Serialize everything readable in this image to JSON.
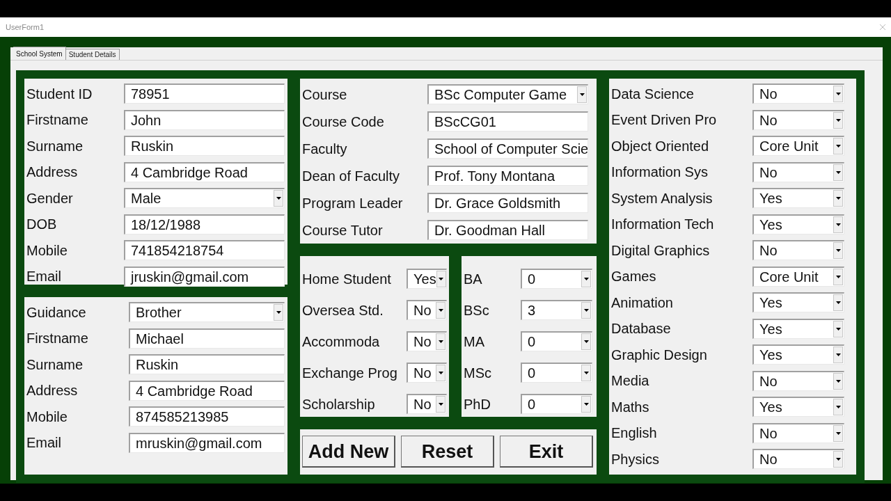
{
  "window": {
    "title": "UserForm1"
  },
  "tabs": [
    {
      "label": "School System",
      "selected": true
    },
    {
      "label": "Student Details",
      "selected": false
    }
  ],
  "student": [
    {
      "label": "Student ID",
      "value": "78951",
      "kind": "text"
    },
    {
      "label": "Firstname",
      "value": "John",
      "kind": "text"
    },
    {
      "label": "Surname",
      "value": "Ruskin",
      "kind": "text"
    },
    {
      "label": "Address",
      "value": "4 Cambridge Road",
      "kind": "text"
    },
    {
      "label": "Gender",
      "value": "Male",
      "kind": "dropdown"
    },
    {
      "label": "DOB",
      "value": "18/12/1988",
      "kind": "text"
    },
    {
      "label": "Mobile",
      "value": "741854218754",
      "kind": "text"
    },
    {
      "label": "Email",
      "value": "jruskin@gmail.com",
      "kind": "text"
    }
  ],
  "guidance": [
    {
      "label": "Guidance",
      "value": "Brother",
      "kind": "dropdown"
    },
    {
      "label": "Firstname",
      "value": "Michael",
      "kind": "text"
    },
    {
      "label": "Surname",
      "value": "Ruskin",
      "kind": "text"
    },
    {
      "label": "Address",
      "value": "4 Cambridge Road",
      "kind": "text"
    },
    {
      "label": "Mobile",
      "value": "874585213985",
      "kind": "text"
    },
    {
      "label": "Email",
      "value": "mruskin@gmail.com",
      "kind": "text"
    }
  ],
  "course": [
    {
      "label": "Course",
      "value": "BSc Computer Game",
      "kind": "dropdown"
    },
    {
      "label": "Course Code",
      "value": "BScCG01",
      "kind": "text"
    },
    {
      "label": "Faculty",
      "value": "School of Computer Scie",
      "kind": "text"
    },
    {
      "label": "Dean of Faculty",
      "value": "Prof. Tony Montana",
      "kind": "text"
    },
    {
      "label": "Program Leader",
      "value": "Dr. Grace Goldsmith",
      "kind": "text"
    },
    {
      "label": "Course Tutor",
      "value": "Dr. Goodman Hall",
      "kind": "text"
    }
  ],
  "status": [
    {
      "label": "Home Student",
      "value": "Yes",
      "kind": "dropdown"
    },
    {
      "label": "Oversea  Std.",
      "value": "No",
      "kind": "dropdown"
    },
    {
      "label": "Accommoda",
      "value": "No",
      "kind": "dropdown"
    },
    {
      "label": "Exchange Prog",
      "value": "No",
      "kind": "dropdown"
    },
    {
      "label": "Scholarship",
      "value": "No",
      "kind": "dropdown"
    }
  ],
  "degrees": [
    {
      "label": "BA",
      "value": "0",
      "kind": "dropdown"
    },
    {
      "label": "BSc",
      "value": "3",
      "kind": "dropdown"
    },
    {
      "label": "MA",
      "value": "0",
      "kind": "dropdown"
    },
    {
      "label": "MSc",
      "value": "0",
      "kind": "dropdown"
    },
    {
      "label": "PhD",
      "value": "0",
      "kind": "dropdown"
    }
  ],
  "buttons": [
    "Add New",
    "Reset",
    "Exit"
  ],
  "units": [
    {
      "label": "Data Science",
      "value": "No",
      "kind": "dropdown"
    },
    {
      "label": "Event Driven Pro",
      "value": "No",
      "kind": "dropdown"
    },
    {
      "label": "Object Oriented",
      "value": "Core Unit",
      "kind": "dropdown"
    },
    {
      "label": "Information Sys",
      "value": "No",
      "kind": "dropdown"
    },
    {
      "label": "System Analysis",
      "value": "Yes",
      "kind": "dropdown"
    },
    {
      "label": "Information Tech",
      "value": "Yes",
      "kind": "dropdown"
    },
    {
      "label": "Digital Graphics",
      "value": "No",
      "kind": "dropdown"
    },
    {
      "label": "Games",
      "value": "Core Unit",
      "kind": "dropdown"
    },
    {
      "label": "Animation",
      "value": "Yes",
      "kind": "dropdown"
    },
    {
      "label": "Database",
      "value": "Yes",
      "kind": "dropdown"
    },
    {
      "label": "Graphic Design",
      "value": "Yes",
      "kind": "dropdown"
    },
    {
      "label": "Media",
      "value": "No",
      "kind": "dropdown"
    },
    {
      "label": "Maths",
      "value": "Yes",
      "kind": "dropdown"
    },
    {
      "label": "English",
      "value": "No",
      "kind": "dropdown"
    },
    {
      "label": "Physics",
      "value": "No",
      "kind": "dropdown"
    }
  ]
}
